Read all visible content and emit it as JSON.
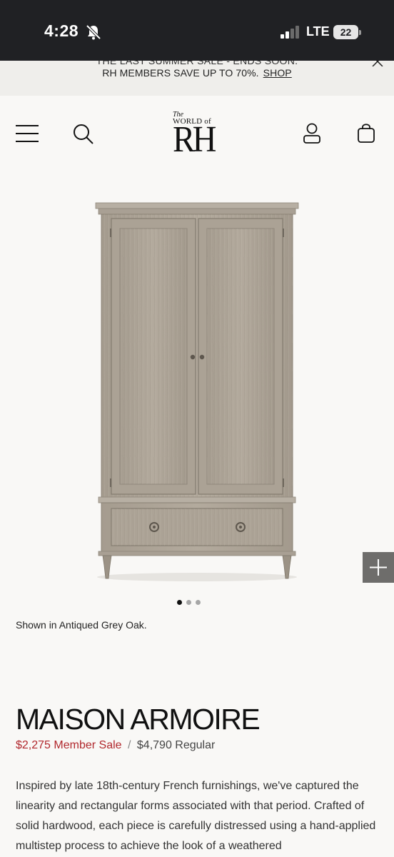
{
  "status_bar": {
    "time": "4:28",
    "network": "LTE",
    "battery": "22",
    "icons": [
      "bell-muted-icon",
      "signal-icon",
      "battery-icon"
    ]
  },
  "promo": {
    "line_partial": "THE LAST SUMMER SALE - ENDS SOON.",
    "text": "RH MEMBERS SAVE UP TO 70%.",
    "link": "SHOP"
  },
  "header": {
    "logo_small": "The",
    "logo_world": "WORLD of",
    "logo_main": "RH",
    "icons": [
      "menu-icon",
      "search-icon",
      "account-icon",
      "cart-icon"
    ]
  },
  "gallery": {
    "slide_count": 3,
    "active_slide": 1,
    "caption": "Shown in Antiqued Grey Oak."
  },
  "product": {
    "title": "MAISON ARMOIRE",
    "member_price": "$2,275",
    "member_label": "Member Sale",
    "separator": "/",
    "regular_price": "$4,790",
    "regular_label": "Regular",
    "description": "Inspired by late 18th-century French furnishings, we've captured the linearity and rectangular forms associated with that period. Crafted of solid hardwood, each piece is carefully distressed using a hand-applied multistep process to achieve the look of a weathered"
  },
  "colors": {
    "status_bar_bg": "#202124",
    "page_bg": "#f9f8f6",
    "banner_bg": "#efeeeb",
    "sale_red": "#b1282d",
    "zoom_button_bg": "#6e6d6b"
  }
}
